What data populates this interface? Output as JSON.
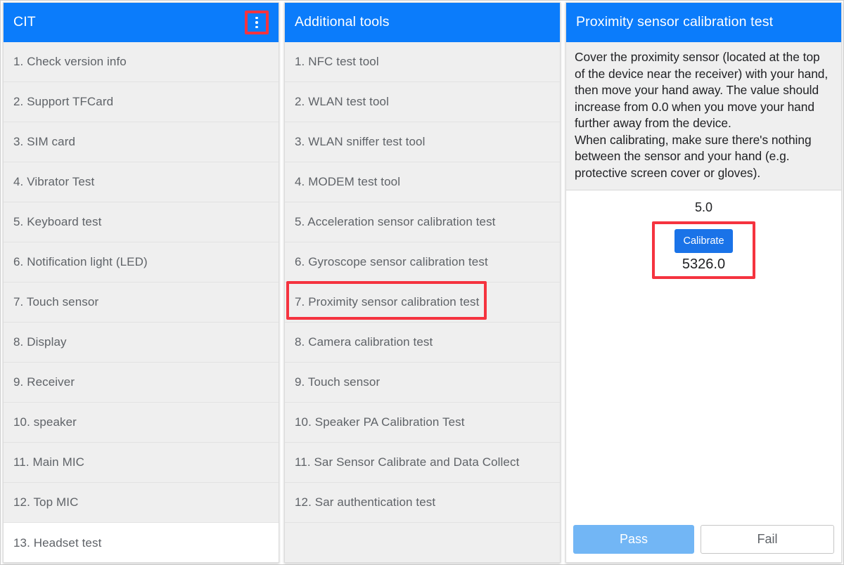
{
  "colors": {
    "appbar_blue": "#0b7cfb",
    "highlight_red": "#f5333f",
    "calibrate_blue": "#1a73e8",
    "pass_blue": "#72b6f5",
    "list_bg": "#efefef",
    "text_gray": "#5f6368"
  },
  "left_panel": {
    "title": "CIT",
    "overflow_icon": "more-vert-icon",
    "items": [
      {
        "label": "1. Check version info"
      },
      {
        "label": "2. Support TFCard"
      },
      {
        "label": "3. SIM card"
      },
      {
        "label": "4. Vibrator Test"
      },
      {
        "label": "5. Keyboard test"
      },
      {
        "label": "6. Notification light (LED)"
      },
      {
        "label": "7. Touch sensor"
      },
      {
        "label": "8. Display"
      },
      {
        "label": "9. Receiver"
      },
      {
        "label": "10. speaker"
      },
      {
        "label": "11. Main MIC"
      },
      {
        "label": "12. Top MIC"
      },
      {
        "label": "13. Headset test"
      }
    ]
  },
  "middle_panel": {
    "title": "Additional tools",
    "highlighted_index": 6,
    "items": [
      {
        "label": "1. NFC test tool"
      },
      {
        "label": "2. WLAN test tool"
      },
      {
        "label": "3. WLAN sniffer test tool"
      },
      {
        "label": "4. MODEM test tool"
      },
      {
        "label": "5. Acceleration sensor calibration test"
      },
      {
        "label": "6. Gyroscope sensor calibration test"
      },
      {
        "label": "7. Proximity sensor calibration test"
      },
      {
        "label": "8. Camera calibration test"
      },
      {
        "label": "9. Touch sensor"
      },
      {
        "label": "10. Speaker PA Calibration Test"
      },
      {
        "label": "11. Sar Sensor Calibrate and Data Collect"
      },
      {
        "label": "12. Sar authentication test"
      },
      {
        "label": ""
      }
    ]
  },
  "right_panel": {
    "title": "Proximity sensor calibration test",
    "instructions": "Cover the proximity sensor (located at the top of the device near the receiver) with your hand, then move your hand away. The value should increase from 0.0 when you move your hand further away from the device.\nWhen calibrating, make sure there's nothing between the sensor and your hand (e.g. protective screen cover or gloves).",
    "value_top": "5.0",
    "calibrate_label": "Calibrate",
    "value_bottom": "5326.0",
    "pass_label": "Pass",
    "fail_label": "Fail"
  }
}
